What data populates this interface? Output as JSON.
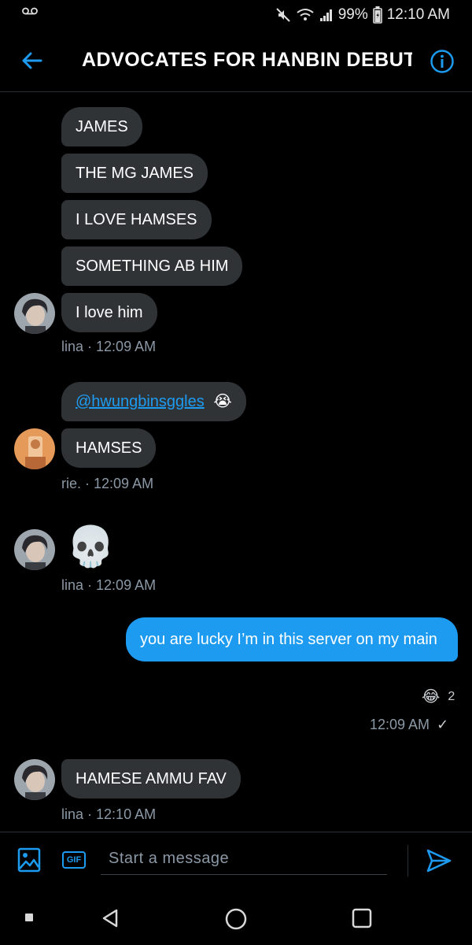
{
  "status_bar": {
    "battery": "99%",
    "time": "12:10 AM",
    "icons": [
      "voicemail-icon",
      "mute-icon",
      "wifi-icon",
      "signal-icon",
      "battery-icon"
    ]
  },
  "header": {
    "title": "ADVOCATES FOR HANBIN DEBUT ...",
    "back_icon": "arrow-left-icon",
    "info_icon": "info-icon"
  },
  "messages": {
    "group1": {
      "bubbles": [
        "JAMES",
        "THE MG JAMES",
        "I LOVE HAMSES",
        "SOMETHING AB HIM",
        "I love him"
      ],
      "sender": "lina",
      "time": "12:09 AM"
    },
    "group2": {
      "mention": "@hwungbinsggles",
      "emoji": "😭",
      "bubble": "HAMSES",
      "sender": "rie.",
      "time": "12:09 AM"
    },
    "group3": {
      "emoji": "💀",
      "sender": "lina",
      "time": "12:09 AM"
    },
    "sent": {
      "text": "you are lucky I’m in this server on my main",
      "reaction_emoji": "😂",
      "reaction_count": "2",
      "time": "12:09 AM",
      "check": "✓"
    },
    "group4": {
      "bubble": "HAMESE AMMU FAV",
      "sender": "lina",
      "time": "12:10 AM"
    },
    "separator": " · "
  },
  "composer": {
    "gif_label": "GIF",
    "placeholder": "Start a message"
  },
  "colors": {
    "accent": "#1d9bf0",
    "bubble": "#2f3336",
    "meta": "#8b98a5"
  }
}
